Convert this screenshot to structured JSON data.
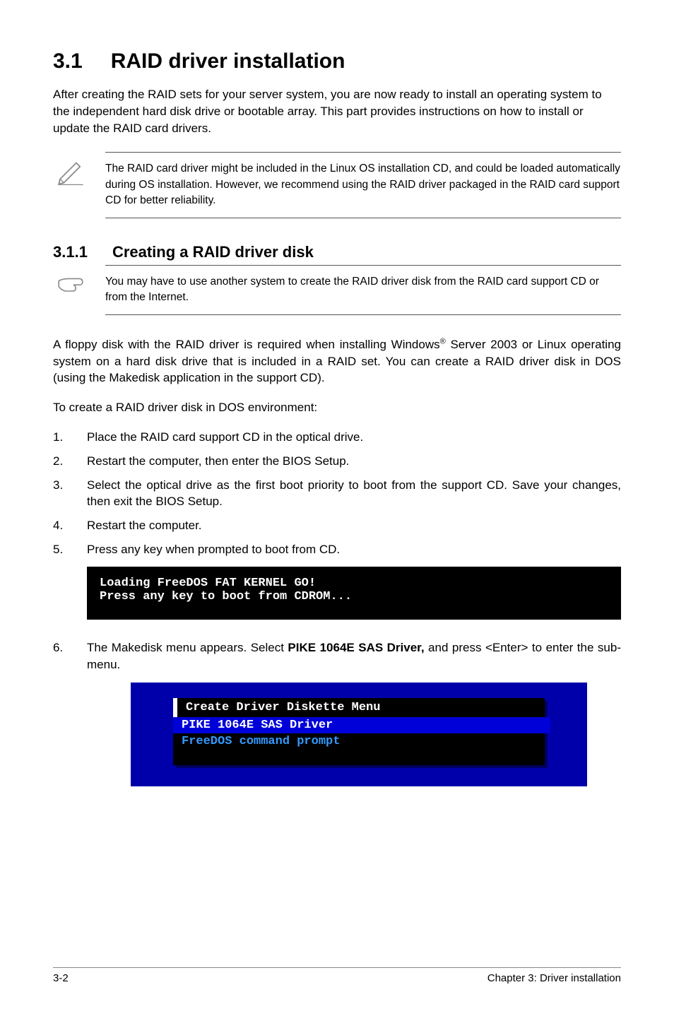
{
  "title": {
    "num": "3.1",
    "text": "RAID driver installation"
  },
  "intro": "After creating the RAID sets for your server system, you are now ready to install an operating system to the independent hard disk drive or bootable array. This part provides instructions on how to install or update the RAID card drivers.",
  "note1": "The RAID card driver might be included in the Linux OS installation CD, and could be loaded automatically during OS installation. However, we recommend using the RAID driver packaged in the RAID card support CD for better reliability.",
  "subtitle": {
    "num": "3.1.1",
    "text": "Creating a RAID driver disk"
  },
  "note2": "You may have to use another system to create the RAID driver disk from the RAID card support CD or from the Internet.",
  "para_a": "A floppy disk with the RAID driver is required when installing Windows",
  "para_a_sup": "®",
  "para_a_cont": " Server 2003 or Linux operating system on a hard disk drive that is included in a RAID set. You can create a RAID driver disk in DOS (using the Makedisk application in the support CD).",
  "para_b": "To create a RAID driver disk in DOS environment:",
  "steps": [
    {
      "n": "1.",
      "t": "Place the RAID card support CD in the optical drive."
    },
    {
      "n": "2.",
      "t": "Restart the computer, then enter the BIOS Setup."
    },
    {
      "n": "3.",
      "t": "Select the optical drive as the first boot priority to boot from the support CD. Save your changes, then exit the BIOS Setup."
    },
    {
      "n": "4.",
      "t": "Restart the computer."
    },
    {
      "n": "5.",
      "t": "Press any key when prompted to boot from CD."
    }
  ],
  "terminal_line1": "Loading FreeDOS FAT KERNEL GO!",
  "terminal_line2": "Press any key to boot from CDROM...",
  "step6": {
    "n": "6.",
    "pre": "The Makedisk menu appears. Select ",
    "bold": "PIKE 1064E SAS Driver,",
    "post": " and press <Enter> to enter the sub-menu."
  },
  "menu": {
    "header": "Create Driver Diskette Menu",
    "selected": "PIKE 1064E SAS Driver",
    "option": "FreeDOS command prompt"
  },
  "footer": {
    "left": "3-2",
    "right": "Chapter 3: Driver installation"
  }
}
